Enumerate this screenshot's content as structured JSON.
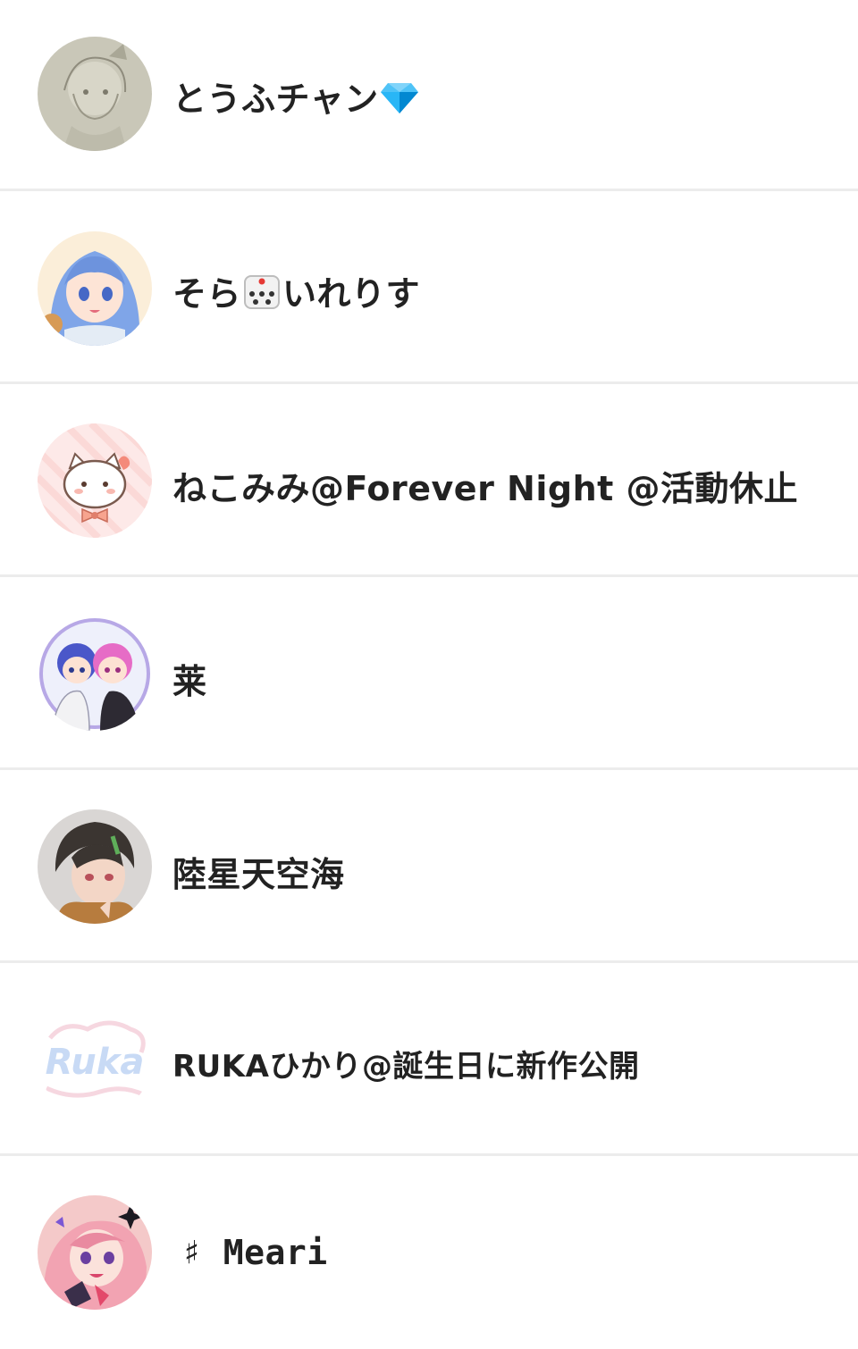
{
  "users": [
    {
      "name": "とうふチャン",
      "emoji": "diamond-icon",
      "avatar": "sketch-girl-avatar"
    },
    {
      "name_before": "そら",
      "emoji": "dice-icon",
      "name_after": "いれりす",
      "avatar": "blue-hair-girl-avatar"
    },
    {
      "name": "ねこみみ@Forever Night @活動休止",
      "avatar": "cat-bow-avatar"
    },
    {
      "name": "莱",
      "avatar": "two-boys-avatar"
    },
    {
      "name": "陸星天空海",
      "avatar": "dark-hair-boy-avatar"
    },
    {
      "name": "RUKAひかり@誕生日に新作公開",
      "avatar": "ruka-logo-avatar",
      "logo_text": "Ruka"
    },
    {
      "name": "♯ Meari",
      "avatar": "pink-hair-girl-avatar"
    }
  ],
  "colors": {
    "divider": "#ececec",
    "text": "#222222",
    "background": "#ffffff"
  }
}
